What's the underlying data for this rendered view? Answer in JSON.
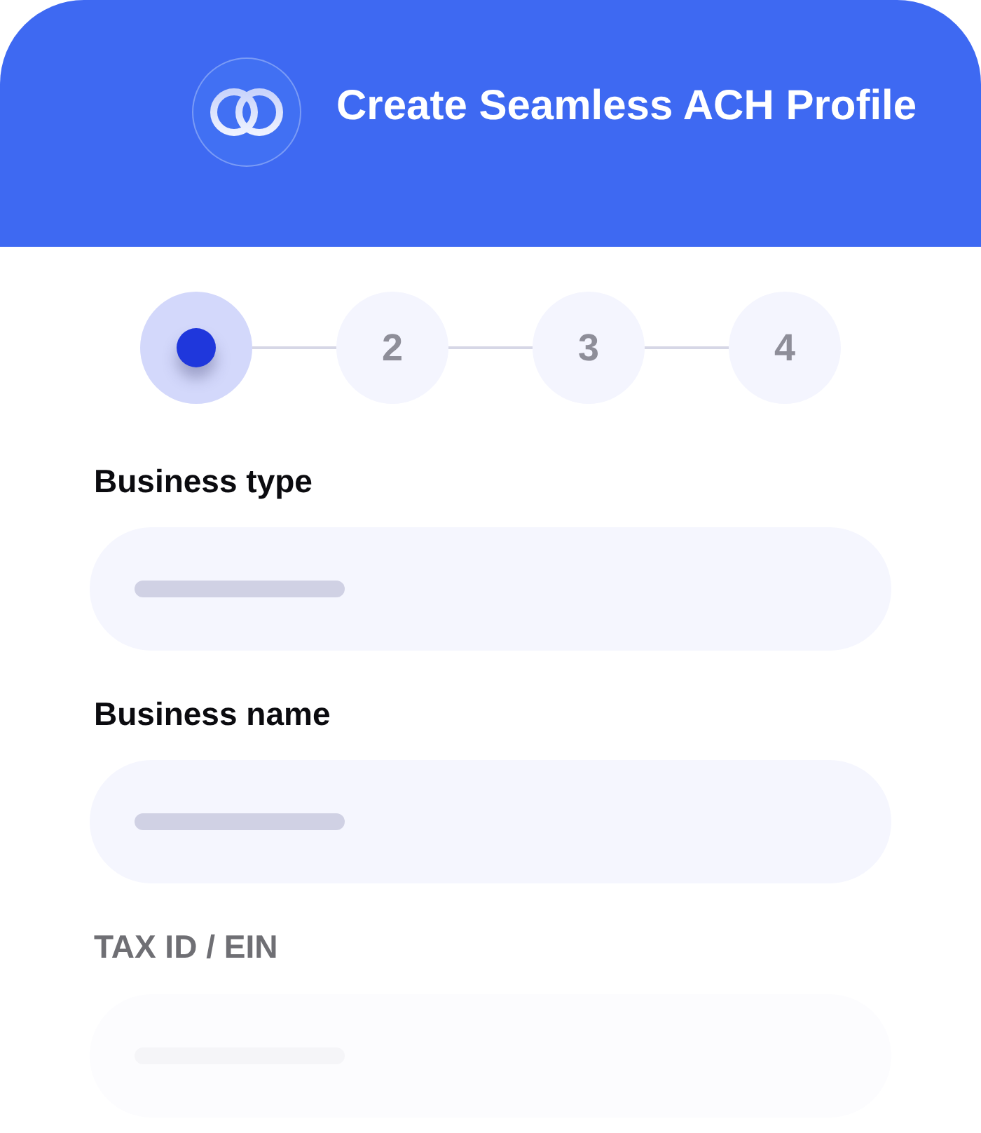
{
  "header": {
    "title": "Create Seamless ACH Profile"
  },
  "steps": [
    {
      "selected": true
    },
    {
      "label": "2",
      "selected": false
    },
    {
      "label": "3",
      "selected": false
    },
    {
      "label": "4",
      "selected": false
    }
  ],
  "fields": [
    {
      "label": "Business type",
      "faded": false
    },
    {
      "label": "Business name",
      "faded": false
    },
    {
      "label": "TAX ID / EIN",
      "faded": true
    }
  ]
}
